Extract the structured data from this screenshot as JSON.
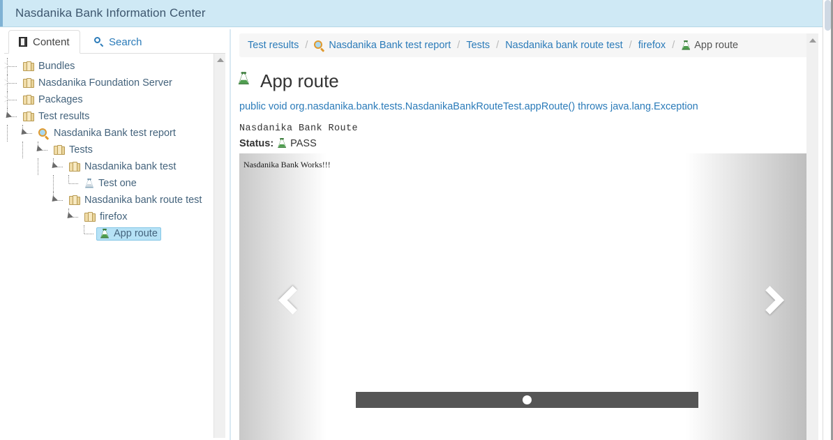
{
  "header": {
    "title": "Nasdanika Bank Information Center"
  },
  "tabs": [
    {
      "label": "Content",
      "icon": "book-icon",
      "active": true
    },
    {
      "label": "Search",
      "icon": "search-icon",
      "active": false
    }
  ],
  "tree": {
    "nodes": [
      {
        "label": "Bundles",
        "icon": "folder-icon",
        "depth": 1,
        "twisty": "collapsed",
        "selected": false
      },
      {
        "label": "Nasdanika Foundation Server",
        "icon": "folder-icon",
        "depth": 1,
        "twisty": "collapsed",
        "selected": false
      },
      {
        "label": "Packages",
        "icon": "folder-icon",
        "depth": 1,
        "twisty": "collapsed",
        "selected": false
      },
      {
        "label": "Test results",
        "icon": "folder-icon",
        "depth": 1,
        "twisty": "expanded",
        "selected": false
      },
      {
        "label": "Nasdanika Bank test report",
        "icon": "magnifier-icon",
        "depth": 2,
        "twisty": "expanded",
        "selected": false
      },
      {
        "label": "Tests",
        "icon": "folder-icon",
        "depth": 3,
        "twisty": "expanded",
        "selected": false
      },
      {
        "label": "Nasdanika bank test",
        "icon": "folder-icon",
        "depth": 4,
        "twisty": "expanded",
        "selected": false
      },
      {
        "label": "Test one",
        "icon": "flask-icon",
        "depth": 5,
        "twisty": "leaf",
        "selected": false
      },
      {
        "label": "Nasdanika bank route test",
        "icon": "folder-icon",
        "depth": 4,
        "twisty": "expanded",
        "selected": false
      },
      {
        "label": "firefox",
        "icon": "folder-icon",
        "depth": 5,
        "twisty": "expanded",
        "selected": false
      },
      {
        "label": "App route",
        "icon": "flask-pass-icon",
        "depth": 6,
        "twisty": "leaf",
        "selected": true
      }
    ]
  },
  "breadcrumb": {
    "items": [
      {
        "label": "Test results",
        "icon": "",
        "current": false
      },
      {
        "label": "Nasdanika Bank test report",
        "icon": "magnifier-icon",
        "current": false
      },
      {
        "label": "Tests",
        "icon": "",
        "current": false
      },
      {
        "label": "Nasdanika bank route test",
        "icon": "",
        "current": false
      },
      {
        "label": "firefox",
        "icon": "",
        "current": false
      },
      {
        "label": "App route",
        "icon": "flask-icon",
        "current": true
      }
    ],
    "separator": "/"
  },
  "main": {
    "title": "App route",
    "signature": "public void org.nasdanika.bank.tests.NasdanikaBankRouteTest.appRoute() throws java.lang.Exception",
    "description": "Nasdanika Bank Route",
    "status_label": "Status:",
    "status_value": "PASS"
  },
  "carousel": {
    "slide_caption": "Nasdanika Bank Works!!!",
    "prev_label": "‹",
    "next_label": "›",
    "slide_count": 1,
    "active_slide": 1
  },
  "colors": {
    "header_bg": "#cfe9f5",
    "accent_link": "#2b7bb9",
    "selection_bg": "#b6e2f6",
    "pass_green": "#4f9e4f",
    "indicator_bar": "#555555"
  }
}
